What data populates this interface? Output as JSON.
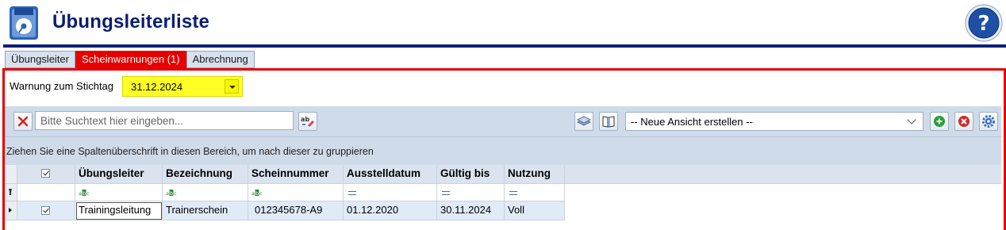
{
  "header": {
    "title": "Übungsleiterliste",
    "app_icon": "disk-icon",
    "help_icon": "question-icon"
  },
  "tabs": [
    {
      "label": "Übungsleiter",
      "active": false
    },
    {
      "label": "Scheinwarnungen (1)",
      "active": true
    },
    {
      "label": "Abrechnung",
      "active": false
    }
  ],
  "filter": {
    "label": "Warnung zum Stichtag",
    "date_value": "31.12.2024"
  },
  "toolbar": {
    "search_placeholder": "Bitte Suchtext hier eingeben...",
    "view_select_value": "-- Neue Ansicht erstellen --"
  },
  "group_area_text": "Ziehen Sie eine Spaltenüberschrift in diesen Bereich, um nach dieser zu gruppieren",
  "grid": {
    "columns": [
      "Übungsleiter",
      "Bezeichnung",
      "Scheinnummer",
      "Ausstelldatum",
      "Gültig bis",
      "Nutzung"
    ],
    "filter_types": [
      "text",
      "text",
      "text",
      "equals",
      "equals",
      "equals"
    ],
    "rows": [
      {
        "checked": true,
        "cells": [
          "Trainingsleitung",
          "Trainerschein",
          "012345678-A9",
          "01.12.2020",
          "30.11.2024",
          "Voll"
        ]
      }
    ]
  },
  "colors": {
    "accent_red": "#e60000",
    "title_blue": "#0a1e6e",
    "highlight_yellow": "#ffff26",
    "toolbar_bg": "#cfdbe8"
  }
}
